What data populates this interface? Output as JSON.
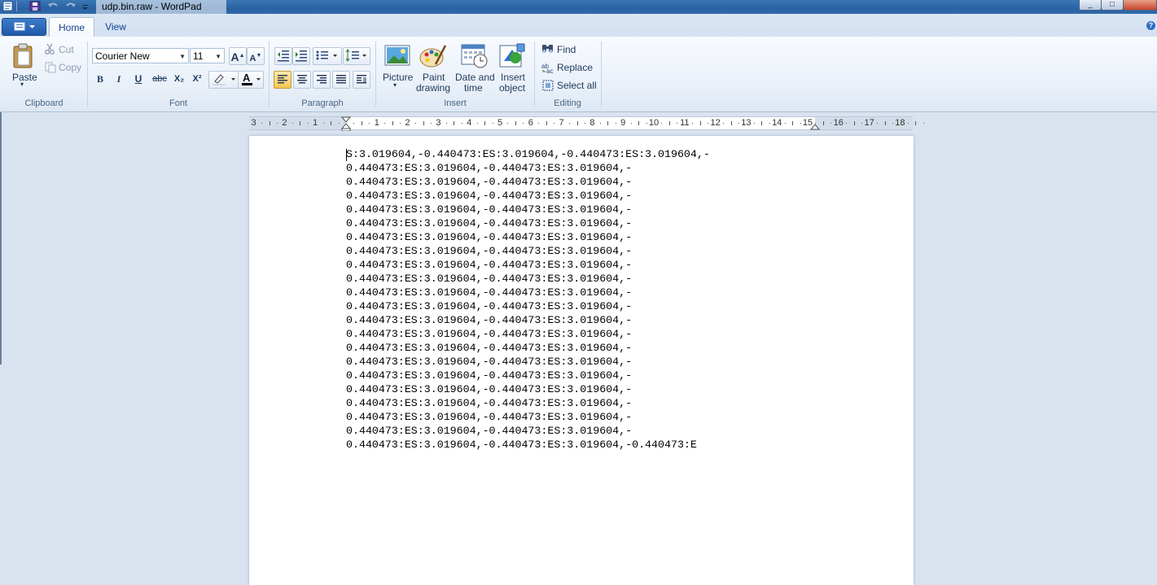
{
  "window": {
    "title": "udp.bin.raw - WordPad"
  },
  "tabs": [
    {
      "label": "Home",
      "active": true
    },
    {
      "label": "View",
      "active": false
    }
  ],
  "clipboard": {
    "paste": "Paste",
    "cut": "Cut",
    "copy": "Copy",
    "group": "Clipboard"
  },
  "font": {
    "family": "Courier New",
    "size": "11",
    "group": "Font",
    "bold": "B",
    "italic": "I",
    "underline": "U",
    "strike": "abc",
    "sub": "X₂",
    "sup": "X²"
  },
  "paragraph": {
    "group": "Paragraph"
  },
  "insert": {
    "picture": "Picture",
    "paint1": "Paint",
    "paint2": "drawing",
    "date1": "Date and",
    "date2": "time",
    "obj1": "Insert",
    "obj2": "object",
    "group": "Insert"
  },
  "editing": {
    "find": "Find",
    "replace": "Replace",
    "selectall": "Select all",
    "group": "Editing"
  },
  "ruler": {
    "labels": [
      "3",
      "2",
      "1",
      "",
      "1",
      "2",
      "3",
      "4",
      "5",
      "6",
      "7",
      "8",
      "9",
      "10",
      "11",
      "12",
      "13",
      "14",
      "15",
      "16",
      "17",
      "18"
    ]
  },
  "document": {
    "lines": [
      "S:3.019604,-0.440473:ES:3.019604,-0.440473:ES:3.019604,-",
      "0.440473:ES:3.019604,-0.440473:ES:3.019604,-",
      "0.440473:ES:3.019604,-0.440473:ES:3.019604,-",
      "0.440473:ES:3.019604,-0.440473:ES:3.019604,-",
      "0.440473:ES:3.019604,-0.440473:ES:3.019604,-",
      "0.440473:ES:3.019604,-0.440473:ES:3.019604,-",
      "0.440473:ES:3.019604,-0.440473:ES:3.019604,-",
      "0.440473:ES:3.019604,-0.440473:ES:3.019604,-",
      "0.440473:ES:3.019604,-0.440473:ES:3.019604,-",
      "0.440473:ES:3.019604,-0.440473:ES:3.019604,-",
      "0.440473:ES:3.019604,-0.440473:ES:3.019604,-",
      "0.440473:ES:3.019604,-0.440473:ES:3.019604,-",
      "0.440473:ES:3.019604,-0.440473:ES:3.019604,-",
      "0.440473:ES:3.019604,-0.440473:ES:3.019604,-",
      "0.440473:ES:3.019604,-0.440473:ES:3.019604,-",
      "0.440473:ES:3.019604,-0.440473:ES:3.019604,-",
      "0.440473:ES:3.019604,-0.440473:ES:3.019604,-",
      "0.440473:ES:3.019604,-0.440473:ES:3.019604,-",
      "0.440473:ES:3.019604,-0.440473:ES:3.019604,-",
      "0.440473:ES:3.019604,-0.440473:ES:3.019604,-",
      "0.440473:ES:3.019604,-0.440473:ES:3.019604,-",
      "0.440473:ES:3.019604,-0.440473:ES:3.019604,-0.440473:E"
    ]
  }
}
